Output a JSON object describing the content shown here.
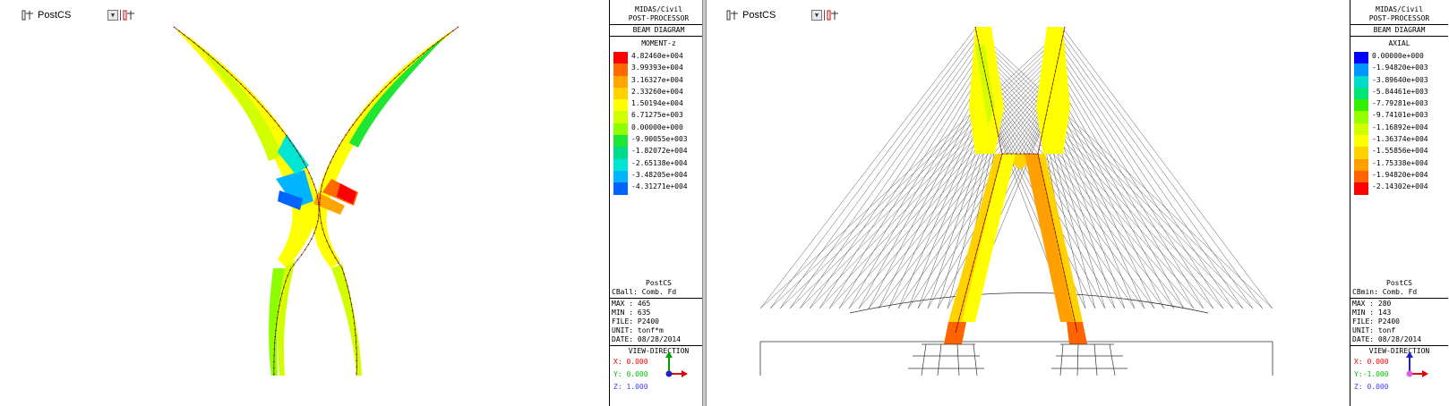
{
  "left": {
    "toolbar": {
      "label": "PostCS"
    },
    "panel": {
      "program": "MIDAS/Civil",
      "module": "POST-PROCESSOR",
      "diagram": "BEAM DIAGRAM",
      "result": "MOMENT-z",
      "legend": [
        {
          "value": "4.82460e+004",
          "color": "#ff0000"
        },
        {
          "value": "3.99393e+004",
          "color": "#ff6a00"
        },
        {
          "value": "3.16327e+004",
          "color": "#ffa500"
        },
        {
          "value": "2.33260e+004",
          "color": "#ffd200"
        },
        {
          "value": "1.50194e+004",
          "color": "#ffff00"
        },
        {
          "value": "6.71275e+003",
          "color": "#d2ff00"
        },
        {
          "value": "0.00000e+000",
          "color": "#8cff00"
        },
        {
          "value": "-9.90055e+003",
          "color": "#1ee632"
        },
        {
          "value": "-1.82072e+004",
          "color": "#00dc8c"
        },
        {
          "value": "-2.65138e+004",
          "color": "#00e6d2"
        },
        {
          "value": "-3.48205e+004",
          "color": "#00b4ff"
        },
        {
          "value": "-4.31271e+004",
          "color": "#0064ff"
        }
      ],
      "stage": "PostCS",
      "combo": "CBall: Comb. Fd",
      "max": "MAX : 465",
      "min": "MIN : 635",
      "file": "FILE: P2400",
      "unit": "UNIT: tonf*m",
      "date": "DATE: 08/28/2014",
      "view_title": "VIEW-DIRECTION",
      "vx": "X: 0.000",
      "vy": "Y: 0.000",
      "vz": "Z: 1.000",
      "vx_color": "#ff0000",
      "vy_color": "#00c000",
      "vz_color": "#4040ff"
    }
  },
  "right": {
    "toolbar": {
      "label": "PostCS"
    },
    "panel": {
      "program": "MIDAS/Civil",
      "module": "POST-PROCESSOR",
      "diagram": "BEAM DIAGRAM",
      "result": "AXIAL",
      "legend": [
        {
          "value": "0.00000e+000",
          "color": "#0000ff"
        },
        {
          "value": "-1.94820e+003",
          "color": "#0096ff"
        },
        {
          "value": "-3.89640e+003",
          "color": "#00dcc8"
        },
        {
          "value": "-5.84461e+003",
          "color": "#00e678"
        },
        {
          "value": "-7.79281e+003",
          "color": "#32f000"
        },
        {
          "value": "-9.74101e+003",
          "color": "#96ff00"
        },
        {
          "value": "-1.16892e+004",
          "color": "#d2ff00"
        },
        {
          "value": "-1.36374e+004",
          "color": "#ffff00"
        },
        {
          "value": "-1.55856e+004",
          "color": "#ffd200"
        },
        {
          "value": "-1.75338e+004",
          "color": "#ffa000"
        },
        {
          "value": "-1.94820e+004",
          "color": "#ff6400"
        },
        {
          "value": "-2.14302e+004",
          "color": "#ff0000"
        }
      ],
      "stage": "PostCS",
      "combo": "CBmin: Comb. Fd",
      "max": "MAX : 280",
      "min": "MIN : 143",
      "file": "FILE: P2400",
      "unit": "UNIT: tonf",
      "date": "DATE: 08/28/2014",
      "view_title": "VIEW-DIRECTION",
      "vx": "X: 0.000",
      "vy": "Y:-1.000",
      "vz": "Z: 0.000",
      "vx_color": "#ff0000",
      "vy_color": "#00c000",
      "vz_color": "#4040ff"
    }
  }
}
